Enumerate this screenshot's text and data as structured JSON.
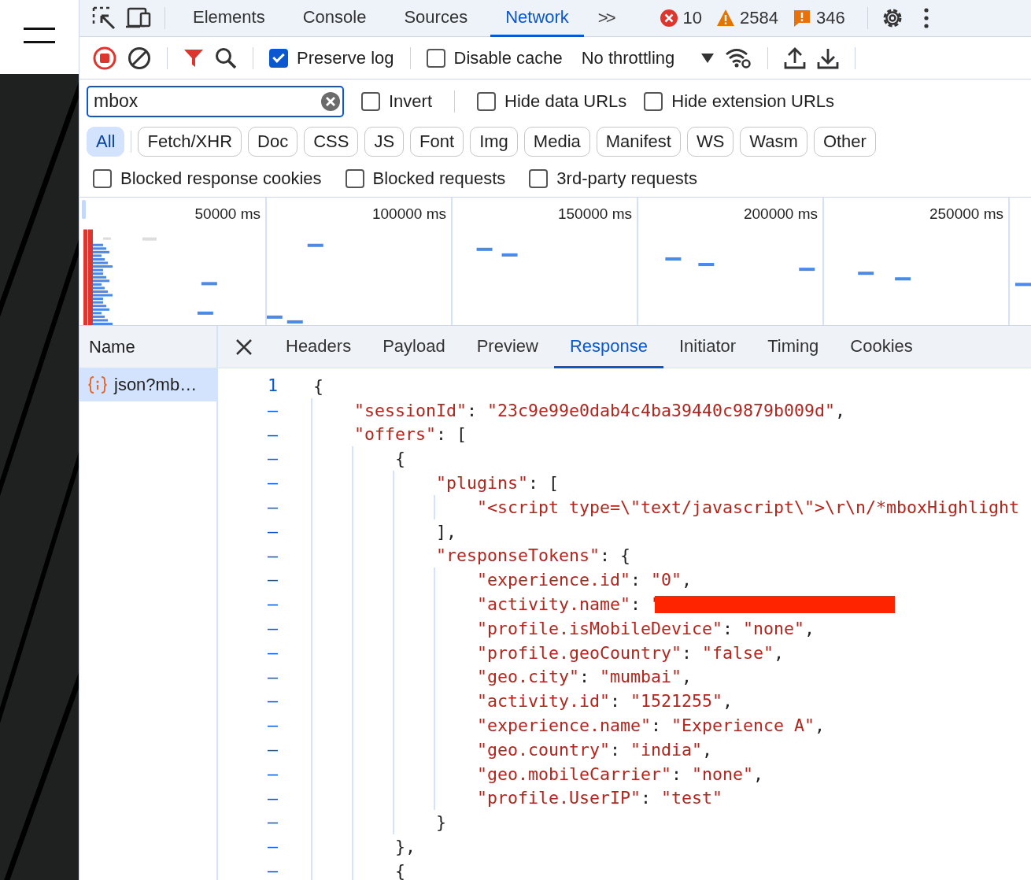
{
  "main_tabs": [
    {
      "label": "Elements",
      "selected": false
    },
    {
      "label": "Console",
      "selected": false
    },
    {
      "label": "Sources",
      "selected": false
    },
    {
      "label": "Network",
      "selected": true
    }
  ],
  "more_tabs": ">>",
  "counts": [
    {
      "kind": "error",
      "text": "10"
    },
    {
      "kind": "warning",
      "text": "2584"
    },
    {
      "kind": "issue",
      "text": "346"
    }
  ],
  "toolbar": {
    "recording": true,
    "filter_active": true,
    "preserve_log": {
      "label": "Preserve log",
      "checked": true
    },
    "disable_cache": {
      "label": "Disable cache",
      "checked": false
    },
    "throttling": "No throttling"
  },
  "filter": {
    "value": "mbox",
    "invert": {
      "label": "Invert",
      "checked": false
    },
    "options": [
      {
        "label": "Hide data URLs",
        "checked": false
      },
      {
        "label": "Hide extension URLs",
        "checked": false
      }
    ]
  },
  "types": [
    {
      "label": "All",
      "selected": true
    },
    {
      "label": "Fetch/XHR",
      "selected": false
    },
    {
      "label": "Doc",
      "selected": false
    },
    {
      "label": "CSS",
      "selected": false
    },
    {
      "label": "JS",
      "selected": false
    },
    {
      "label": "Font",
      "selected": false
    },
    {
      "label": "Img",
      "selected": false
    },
    {
      "label": "Media",
      "selected": false
    },
    {
      "label": "Manifest",
      "selected": false
    },
    {
      "label": "WS",
      "selected": false
    },
    {
      "label": "Wasm",
      "selected": false
    },
    {
      "label": "Other",
      "selected": false
    }
  ],
  "blocked": [
    {
      "label": "Blocked response cookies",
      "checked": false
    },
    {
      "label": "Blocked requests",
      "checked": false
    },
    {
      "label": "3rd-party requests",
      "checked": false
    }
  ],
  "overview": {
    "ticks": [
      "50000 ms",
      "100000 ms",
      "150000 ms",
      "200000 ms",
      "250000 ms"
    ]
  },
  "requests": {
    "column": "Name",
    "rows": [
      {
        "name": "json?mb…",
        "selected": true
      }
    ]
  },
  "detail_tabs": [
    {
      "label": "Headers",
      "selected": false
    },
    {
      "label": "Payload",
      "selected": false
    },
    {
      "label": "Preview",
      "selected": false
    },
    {
      "label": "Response",
      "selected": true
    },
    {
      "label": "Initiator",
      "selected": false
    },
    {
      "label": "Timing",
      "selected": false
    },
    {
      "label": "Cookies",
      "selected": false
    }
  ],
  "response": [
    {
      "gutter": "1",
      "parts": [
        {
          "kind": "punct",
          "text": "{"
        }
      ],
      "children": [
        {
          "gutter": "–",
          "parts": [
            {
              "kind": "key",
              "text": "\"sessionId\""
            },
            {
              "kind": "punct",
              "text": ": "
            },
            {
              "kind": "string",
              "text": "\"23c9e99e0dab4c4ba39440c9879b009d\""
            },
            {
              "kind": "punct",
              "text": ","
            }
          ]
        },
        {
          "gutter": "–",
          "parts": [
            {
              "kind": "key",
              "text": "\"offers\""
            },
            {
              "kind": "punct",
              "text": ": ["
            }
          ],
          "children": [
            {
              "gutter": "–",
              "parts": [
                {
                  "kind": "punct",
                  "text": "{"
                }
              ],
              "children": [
                {
                  "gutter": "–",
                  "parts": [
                    {
                      "kind": "key",
                      "text": "\"plugins\""
                    },
                    {
                      "kind": "punct",
                      "text": ": ["
                    }
                  ],
                  "children": [
                    {
                      "gutter": "–",
                      "parts": [
                        {
                          "kind": "string",
                          "text": "\"<script type=\\\"text/javascript\\\">\\r\\n/*mboxHighlight"
                        }
                      ]
                    }
                  ]
                },
                {
                  "gutter": "–",
                  "parts": [
                    {
                      "kind": "punct",
                      "text": "],"
                    }
                  ]
                },
                {
                  "gutter": "–",
                  "parts": [
                    {
                      "kind": "key",
                      "text": "\"responseTokens\""
                    },
                    {
                      "kind": "punct",
                      "text": ": {"
                    }
                  ],
                  "children": [
                    {
                      "gutter": "–",
                      "parts": [
                        {
                          "kind": "key",
                          "text": "\"experience.id\""
                        },
                        {
                          "kind": "punct",
                          "text": ": "
                        },
                        {
                          "kind": "string",
                          "text": "\"0\""
                        },
                        {
                          "kind": "punct",
                          "text": ","
                        }
                      ]
                    },
                    {
                      "gutter": "–",
                      "parts": [
                        {
                          "kind": "key",
                          "text": "\"activity.name\""
                        },
                        {
                          "kind": "punct",
                          "text": ": "
                        },
                        {
                          "kind": "string",
                          "text": "\""
                        },
                        {
                          "kind": "redaction"
                        }
                      ]
                    },
                    {
                      "gutter": "–",
                      "parts": [
                        {
                          "kind": "key",
                          "text": "\"profile.isMobileDevice\""
                        },
                        {
                          "kind": "punct",
                          "text": ": "
                        },
                        {
                          "kind": "string",
                          "text": "\"none\""
                        },
                        {
                          "kind": "punct",
                          "text": ","
                        }
                      ]
                    },
                    {
                      "gutter": "–",
                      "parts": [
                        {
                          "kind": "key",
                          "text": "\"profile.geoCountry\""
                        },
                        {
                          "kind": "punct",
                          "text": ": "
                        },
                        {
                          "kind": "string",
                          "text": "\"false\""
                        },
                        {
                          "kind": "punct",
                          "text": ","
                        }
                      ]
                    },
                    {
                      "gutter": "–",
                      "parts": [
                        {
                          "kind": "key",
                          "text": "\"geo.city\""
                        },
                        {
                          "kind": "punct",
                          "text": ": "
                        },
                        {
                          "kind": "string",
                          "text": "\"mumbai\""
                        },
                        {
                          "kind": "punct",
                          "text": ","
                        }
                      ]
                    },
                    {
                      "gutter": "–",
                      "parts": [
                        {
                          "kind": "key",
                          "text": "\"activity.id\""
                        },
                        {
                          "kind": "punct",
                          "text": ": "
                        },
                        {
                          "kind": "string",
                          "text": "\"1521255\""
                        },
                        {
                          "kind": "punct",
                          "text": ","
                        }
                      ]
                    },
                    {
                      "gutter": "–",
                      "parts": [
                        {
                          "kind": "key",
                          "text": "\"experience.name\""
                        },
                        {
                          "kind": "punct",
                          "text": ": "
                        },
                        {
                          "kind": "string",
                          "text": "\"Experience A\""
                        },
                        {
                          "kind": "punct",
                          "text": ","
                        }
                      ]
                    },
                    {
                      "gutter": "–",
                      "parts": [
                        {
                          "kind": "key",
                          "text": "\"geo.country\""
                        },
                        {
                          "kind": "punct",
                          "text": ": "
                        },
                        {
                          "kind": "string",
                          "text": "\"india\""
                        },
                        {
                          "kind": "punct",
                          "text": ","
                        }
                      ]
                    },
                    {
                      "gutter": "–",
                      "parts": [
                        {
                          "kind": "key",
                          "text": "\"geo.mobileCarrier\""
                        },
                        {
                          "kind": "punct",
                          "text": ": "
                        },
                        {
                          "kind": "string",
                          "text": "\"none\""
                        },
                        {
                          "kind": "punct",
                          "text": ","
                        }
                      ]
                    },
                    {
                      "gutter": "–",
                      "parts": [
                        {
                          "kind": "key",
                          "text": "\"profile.UserIP\""
                        },
                        {
                          "kind": "punct",
                          "text": ": "
                        },
                        {
                          "kind": "string",
                          "text": "\"test\""
                        }
                      ]
                    }
                  ]
                },
                {
                  "gutter": "–",
                  "parts": [
                    {
                      "kind": "punct",
                      "text": "}"
                    }
                  ]
                }
              ]
            },
            {
              "gutter": "–",
              "parts": [
                {
                  "kind": "punct",
                  "text": "},"
                }
              ]
            },
            {
              "gutter": "–",
              "parts": [
                {
                  "kind": "punct",
                  "text": "{"
                }
              ]
            }
          ]
        }
      ]
    }
  ]
}
